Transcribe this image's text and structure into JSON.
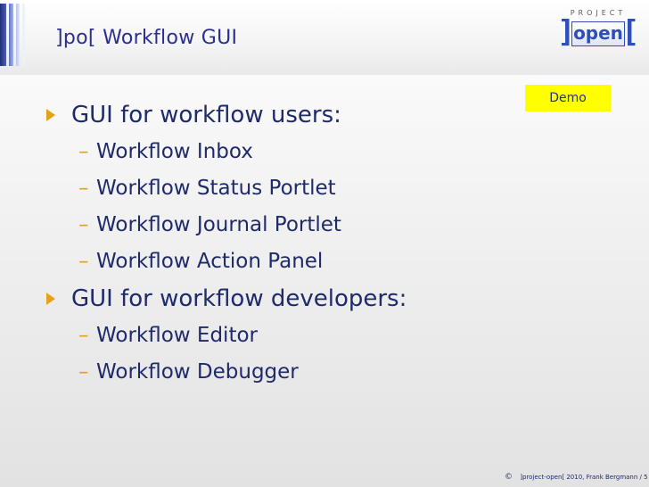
{
  "slide": {
    "title": "]po[ Workflow GUI",
    "demo_label": "Demo"
  },
  "logo": {
    "top_text": "PROJECT",
    "left_bracket": "]",
    "main_text": "open",
    "right_bracket": "["
  },
  "bullets": [
    {
      "label": "GUI for workflow users:",
      "sub": [
        "Workflow Inbox",
        "Workflow Status Portlet",
        "Workflow Journal Portlet",
        "Workflow Action Panel"
      ]
    },
    {
      "label": "GUI for workflow developers:",
      "sub": [
        "Workflow Editor",
        "Workflow Debugger"
      ]
    }
  ],
  "footer": {
    "copyright_symbol": "©",
    "text": "]project-open[  2010, Frank Bergmann / 5"
  },
  "colors": {
    "title": "#2b2f8f",
    "bullet": "#e3a21a",
    "demo_bg": "#ffff00",
    "logo": "#2f4fb8"
  }
}
